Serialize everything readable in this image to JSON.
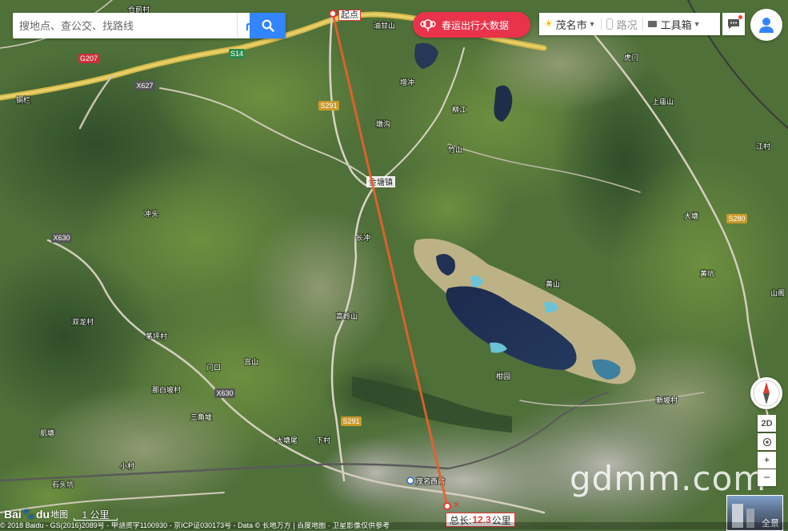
{
  "search": {
    "placeholder": "搜地点、查公交、找路线"
  },
  "promo": {
    "label": "春运出行大数据"
  },
  "toolbar": {
    "city": "茂名市",
    "traffic": "路况",
    "tools": "工具箱"
  },
  "measure": {
    "start_label": "起点",
    "total_prefix": "总长:",
    "total_value": "12.3",
    "unit": "公里",
    "route_color": "#e8602c"
  },
  "map_labels": {
    "jintang_town": "金塘镇",
    "station": "茂名西站",
    "hedong": "山阁",
    "places": [
      "仓前村",
      "油甘山",
      "铜栏",
      "增冲",
      "柳江",
      "虎门",
      "上庙山",
      "竹山",
      "江村",
      "黄坑",
      "长冲",
      "墩沟",
      "黄山",
      "冲头",
      "双龙村",
      "茅坪村",
      "门口",
      "那白坡村",
      "三角墟",
      "肌塘",
      "大塘尾",
      "新坡村",
      "宫山",
      "柑园",
      "大塘",
      "下村",
      "小村",
      "石头坑",
      "高岭山"
    ]
  },
  "roads": {
    "g207": "G207",
    "s14": "S14",
    "s291_a": "S291",
    "s291_b": "S291",
    "x627": "X627",
    "x630_a": "X630",
    "x630_b": "X630",
    "s280": "S280"
  },
  "controls": {
    "view_2d": "2D",
    "zoom_in": "+",
    "zoom_out": "−"
  },
  "scale": {
    "label": "1 公里"
  },
  "logo": {
    "brand_prefix": "Bai",
    "brand_suffix": "du",
    "sub": "地图"
  },
  "watermark": "gdmm.com",
  "panorama": {
    "label": "全景"
  },
  "copyright": "© 2018 Baidu - GS(2016)2089号 - 甲测资字1100930 - 京ICP证030173号 - Data © 长地万方 | 百度地图 · 卫星影像仅供参考"
}
